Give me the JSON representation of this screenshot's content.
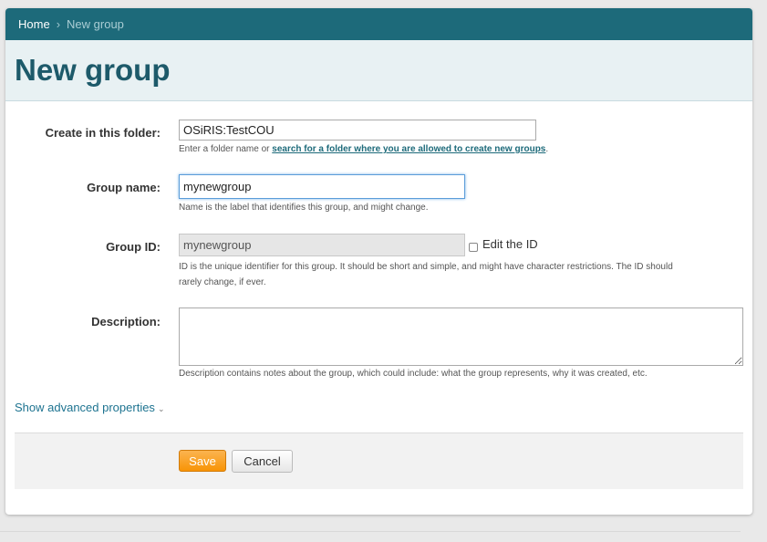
{
  "breadcrumb": {
    "home": "Home",
    "separator": "›",
    "current": "New group"
  },
  "page_title": "New group",
  "form": {
    "folder": {
      "label": "Create in this folder:",
      "value": "OSiRIS:TestCOU",
      "help_prefix": "Enter a folder name or ",
      "help_link": "search for a folder where you are allowed to create new groups",
      "help_suffix": "."
    },
    "group_name": {
      "label": "Group name:",
      "value": "mynewgroup",
      "help": "Name is the label that identifies this group, and might change."
    },
    "group_id": {
      "label": "Group ID:",
      "value": "mynewgroup",
      "checkbox_label": "Edit the ID",
      "help_line1": "ID is the unique identifier for this group. It should be short and simple, and might have character restrictions. The ID should",
      "help_line2": "rarely change, if ever."
    },
    "description": {
      "label": "Description:",
      "value": "",
      "help": "Description contains notes about the group, which could include: what the group represents, why it was created, etc."
    }
  },
  "advanced_link": "Show advanced properties",
  "buttons": {
    "save": "Save",
    "cancel": "Cancel"
  },
  "colors": {
    "header": "#1d6a7a",
    "title": "#1d5a6a",
    "save": "#f89406"
  }
}
